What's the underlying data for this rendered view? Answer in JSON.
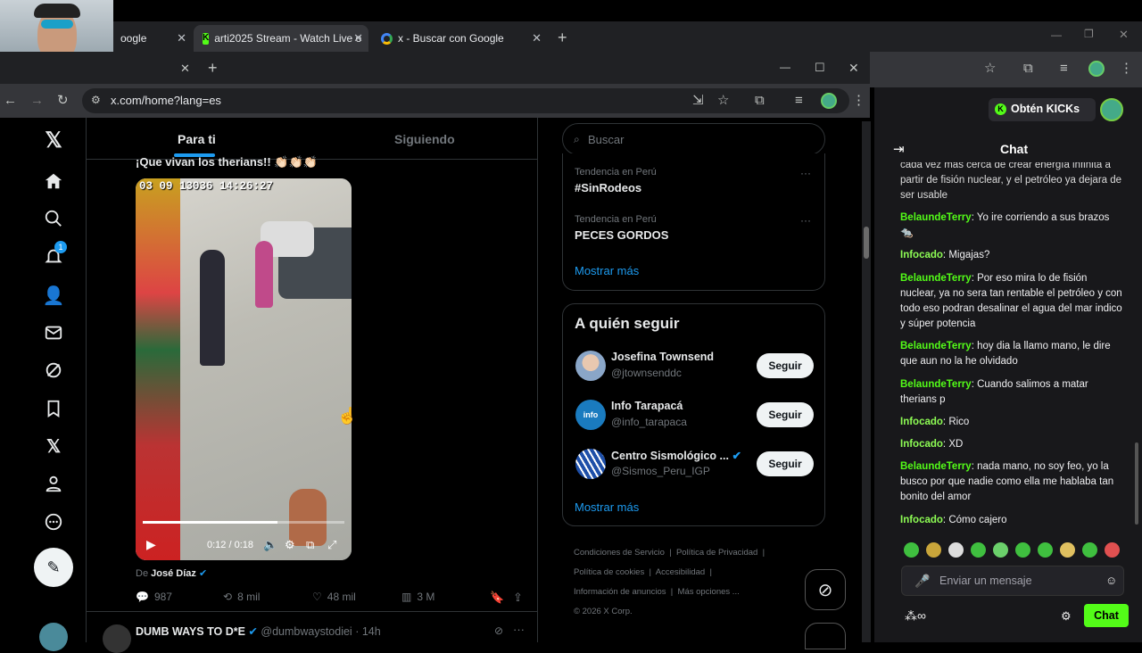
{
  "outer_tabs": [
    {
      "label": "oogle"
    },
    {
      "label": "arti2025 Stream - Watch Live o"
    },
    {
      "label": "x - Buscar con Google"
    }
  ],
  "url": "x.com/home?lang=es",
  "feed": {
    "tabs": [
      "Para ti",
      "Siguiendo"
    ],
    "post_text": "¡Que vivan los therians!! 👏🏻👏🏻👏🏻",
    "video_timestamp": "03 09 13036 14:26:27",
    "video_time": "0:12 / 0:18",
    "video_progress": 0.67,
    "source_prefix": "De",
    "source_name": "José Díaz",
    "stats": {
      "replies": "987",
      "reposts": "8 mil",
      "likes": "48 mil",
      "views": "3 M"
    },
    "next_post_author": "DUMB WAYS TO D*E",
    "next_post_handle": "@dumbwaystodiei",
    "next_post_time": "· 14h",
    "nav_badge": "1"
  },
  "sidebar": {
    "search_placeholder": "Buscar",
    "trends": [
      {
        "context": "Tendencia en Perú",
        "title": "#SinRodeos"
      },
      {
        "context": "Tendencia en Perú",
        "title": "PECES GORDOS"
      }
    ],
    "show_more": "Mostrar más",
    "who_to_follow_title": "A quién seguir",
    "suggestions": [
      {
        "name": "Josefina Townsend",
        "handle": "@jtownsenddc",
        "button": "Seguir"
      },
      {
        "name": "Info Tarapacá",
        "handle": "@info_tarapaca",
        "button": "Seguir"
      },
      {
        "name": "Centro Sismológico ...",
        "handle": "@Sismos_Peru_IGP",
        "button": "Seguir"
      }
    ],
    "show_more_2": "Mostrar más",
    "footer": {
      "terms": "Condiciones de Servicio",
      "privacy": "Política de Privacidad",
      "cookies": "Política de cookies",
      "accessibility": "Accesibilidad",
      "ads": "Información de anuncios",
      "more": "Más opciones ...",
      "copyright": "© 2026 X Corp."
    }
  },
  "kick": {
    "get_kicks": "Obtén KICKs",
    "chat_title": "Chat",
    "messages": [
      {
        "user": "",
        "text": "cada vez más cerca de crear energía infinita a partir de fisión nuclear, y el petróleo ya dejara de ser usable"
      },
      {
        "user": "BelaundeTerry",
        "text": "Yo ire corriendo a sus brazos"
      },
      {
        "user": "Infocado",
        "text": "Migajas?"
      },
      {
        "user": "BelaundeTerry",
        "text": "Por eso mira lo de fisión nuclear, ya no sera tan rentable el petróleo y con todo eso podran desalinar el agua del mar indico y súper potencia"
      },
      {
        "user": "BelaundeTerry",
        "text": "hoy dia la llamo mano, le dire que aun no la he olvidado"
      },
      {
        "user": "BelaundeTerry",
        "text": "Cuando salimos a matar therians p"
      },
      {
        "user": "Infocado",
        "text": "Rico"
      },
      {
        "user": "Infocado",
        "text": "XD"
      },
      {
        "user": "BelaundeTerry",
        "text": "nada mano, no soy feo, yo la busco por que nadie como ella me hablaba tan bonito del amor"
      },
      {
        "user": "Infocado",
        "text": "Cómo cajero"
      }
    ],
    "input_placeholder": "Enviar un mensaje",
    "send_label": "Chat"
  }
}
